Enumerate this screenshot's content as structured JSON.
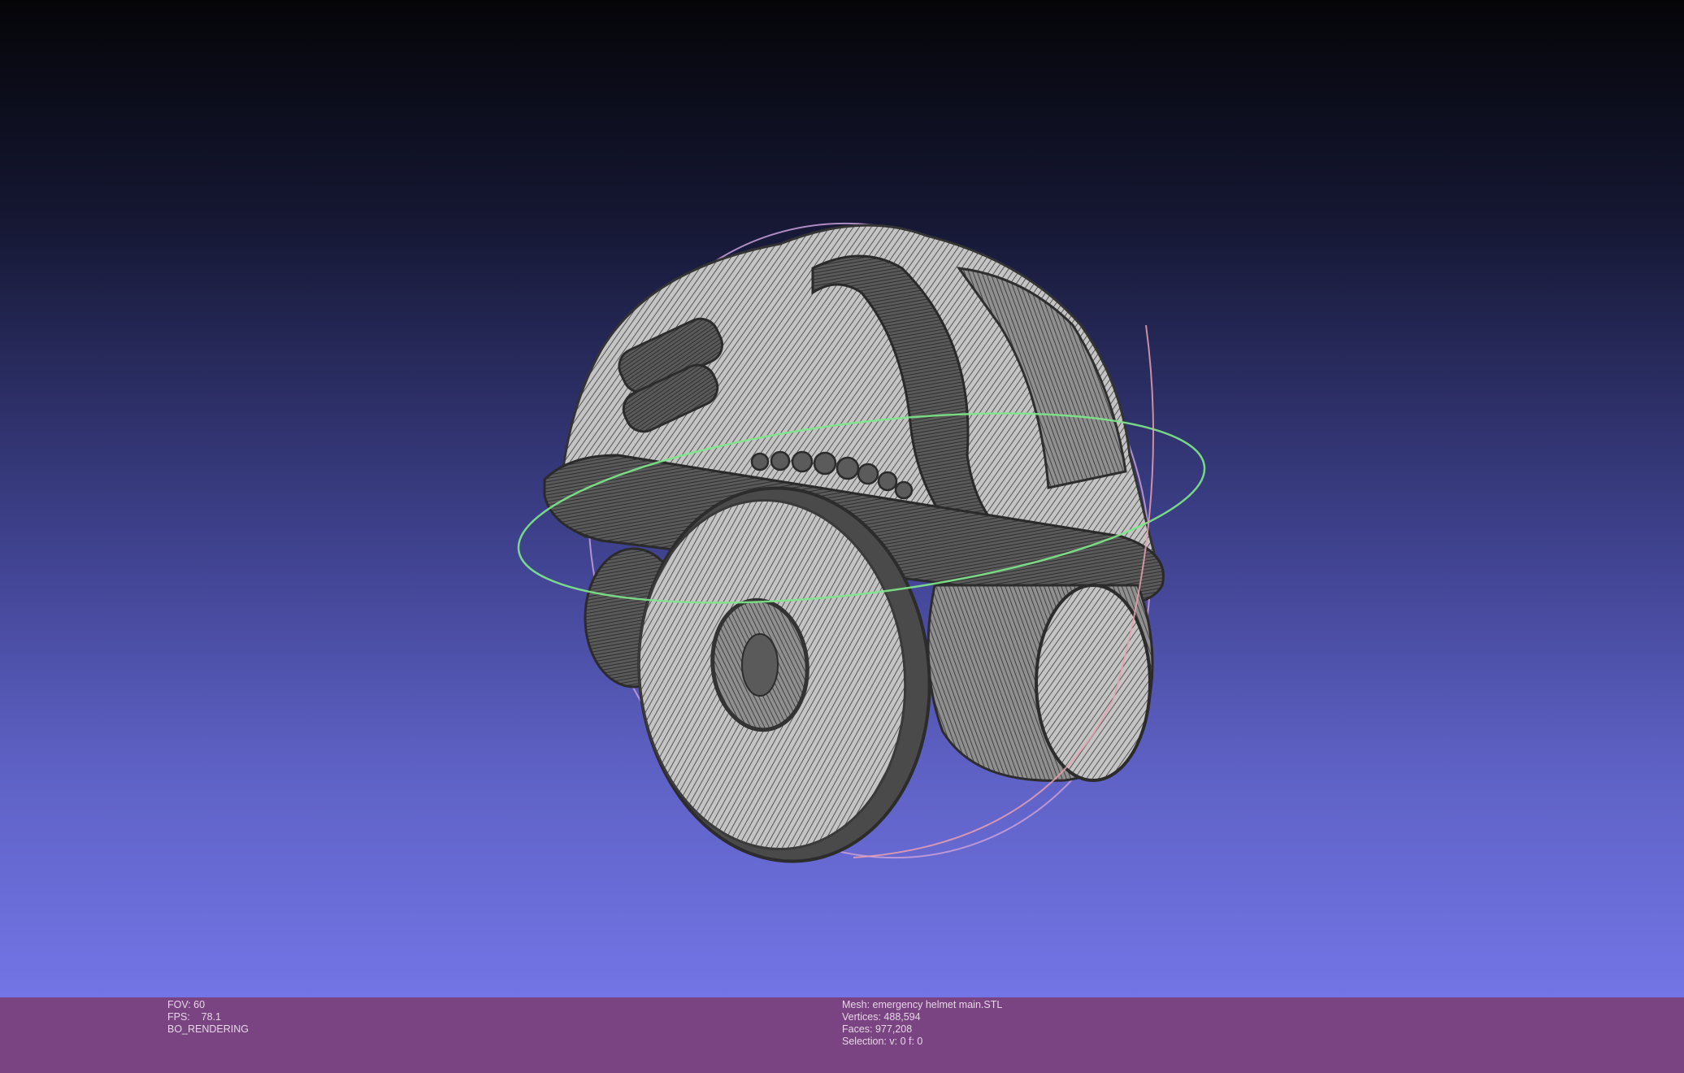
{
  "status": {
    "left": {
      "fov": "FOV: 60",
      "fps": "FPS:    78.1",
      "rendering": "BO_RENDERING"
    },
    "right": {
      "mesh": "Mesh: emergency helmet main.STL",
      "vertices": "Vertices: 488,594",
      "faces": "Faces: 977,208",
      "selection": "Selection: v: 0 f: 0"
    }
  },
  "colors": {
    "status_bar": "#7a4482",
    "mesh_fill": "#bdbdbd",
    "mesh_wire": "#3a3a3a",
    "trackball_x": "#7ee88a",
    "trackball_y": "#c9a0d8",
    "trackball_z": "#e9a0b0"
  },
  "icons": {
    "trackball": "trackball-rings-icon",
    "model": "wireframe-mesh-icon"
  }
}
